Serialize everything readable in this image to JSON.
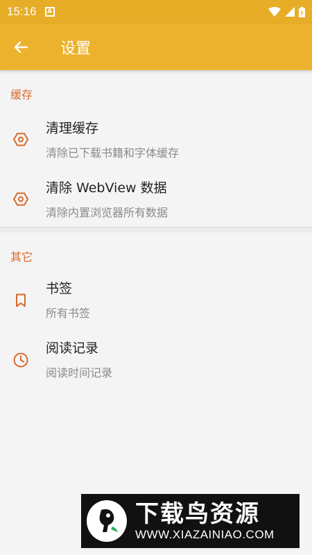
{
  "status_bar": {
    "time": "15:16",
    "notification_icon": "A"
  },
  "app_bar": {
    "title": "设置"
  },
  "sections": [
    {
      "header": "缓存",
      "items": [
        {
          "title": "清理缓存",
          "subtitle": "清除已下载书籍和字体缓存",
          "icon": "hexagon-icon"
        },
        {
          "title": "清除 WebView 数据",
          "subtitle": "清除内置浏览器所有数据",
          "icon": "hexagon-icon"
        }
      ]
    },
    {
      "header": "其它",
      "items": [
        {
          "title": "书签",
          "subtitle": "所有书签",
          "icon": "bookmark-icon"
        },
        {
          "title": "阅读记录",
          "subtitle": "阅读时间记录",
          "icon": "clock-icon"
        }
      ]
    }
  ],
  "watermark": {
    "title": "下载鸟资源",
    "url": "WWW.XIAZAINIAO.COM"
  },
  "colors": {
    "status_bar": "#e7ad27",
    "app_bar": "#edb22d",
    "accent": "#d9672b"
  }
}
